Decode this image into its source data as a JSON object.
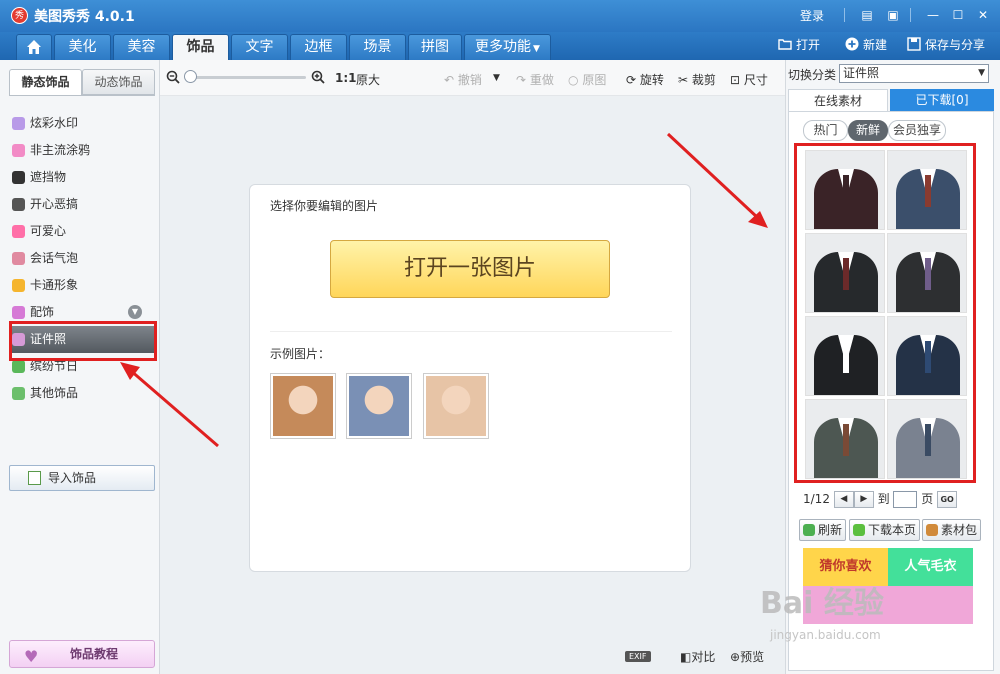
{
  "app": {
    "title": "美图秀秀 4.0.1",
    "logo_text": "秀",
    "login": "登录"
  },
  "nav": {
    "home_icon": "home-icon",
    "tabs": [
      {
        "label": "美化"
      },
      {
        "label": "美容"
      },
      {
        "label": "饰品"
      },
      {
        "label": "文字"
      },
      {
        "label": "边框"
      },
      {
        "label": "场景"
      },
      {
        "label": "拼图"
      },
      {
        "label": "更多功能"
      }
    ],
    "active_tab": "饰品",
    "actions": {
      "open": "打开",
      "new": "新建",
      "save_share": "保存与分享"
    }
  },
  "toolbar": {
    "zoom_ratio": "1:1",
    "original_size": "原大",
    "undo": "撤销",
    "redo": "重做",
    "original_image": "原图",
    "rotate": "旋转",
    "crop": "裁剪",
    "size": "尺寸"
  },
  "left": {
    "tabs": [
      "静态饰品",
      "动态饰品"
    ],
    "categories": [
      {
        "label": "炫彩水印",
        "color": "#b89ae8"
      },
      {
        "label": "非主流涂鸦",
        "color": "#f28bc6"
      },
      {
        "label": "遮挡物",
        "color": "#333333"
      },
      {
        "label": "开心恶搞",
        "color": "#555555"
      },
      {
        "label": "可爱心",
        "color": "#ff6fa8"
      },
      {
        "label": "会话气泡",
        "color": "#e08aa0"
      },
      {
        "label": "卡通形象",
        "color": "#f5b52e"
      },
      {
        "label": "配饰",
        "color": "#d67ad6"
      },
      {
        "label": "证件照",
        "color": "#d69ad6"
      },
      {
        "label": "缤纷节日",
        "color": "#5ab85a"
      },
      {
        "label": "其他饰品",
        "color": "#6cbf6c"
      }
    ],
    "import_button": "导入饰品",
    "tutorial_button": "饰品教程"
  },
  "center": {
    "prompt": "选择你要编辑的图片",
    "open_button": "打开一张图片",
    "sample_label": "示例图片：",
    "samples": [
      {
        "name": "sample-photo-woman-long-hair",
        "color": "#c58a5a"
      },
      {
        "name": "sample-photo-woman-smiling",
        "color": "#7a90b5"
      },
      {
        "name": "sample-photo-baby",
        "color": "#e7c4a6"
      }
    ],
    "exif": "EXIF",
    "compare": "对比",
    "preview": "预览"
  },
  "right": {
    "switch_label": "切换分类",
    "switch_value": "证件照",
    "tabs": [
      "在线素材",
      "已下载[0]"
    ],
    "subtabs": [
      "热门",
      "新鲜",
      "会员独享"
    ],
    "active_subtab": "新鲜",
    "suits": [
      {
        "jacket": "#3a2327",
        "tie": "#3a2327"
      },
      {
        "jacket": "#3b4f6b",
        "tie": "#8a3b30"
      },
      {
        "jacket": "#26292c",
        "tie": "#6b2a2a"
      },
      {
        "jacket": "#2d2f31",
        "tie": "#6f5d8a"
      },
      {
        "jacket": "#1f2124",
        "tie": "#ffffff"
      },
      {
        "jacket": "#243247",
        "tie": "#2e4a73"
      },
      {
        "jacket": "#4d5752",
        "tie": "#7a4a36"
      },
      {
        "jacket": "#7a8290",
        "tie": "#3a4b63"
      }
    ],
    "pager": {
      "current": "1/12",
      "go_to": "到",
      "page_unit": "页",
      "go": "GO"
    },
    "actions": {
      "refresh": "刷新",
      "download_page": "下载本页",
      "material_pack": "素材包"
    },
    "banners": {
      "guess_you_like": "猜你喜欢",
      "popular_hair": "人气毛衣"
    }
  },
  "watermark": {
    "brand": "Bai  经验",
    "url": "jingyan.baidu.com"
  }
}
